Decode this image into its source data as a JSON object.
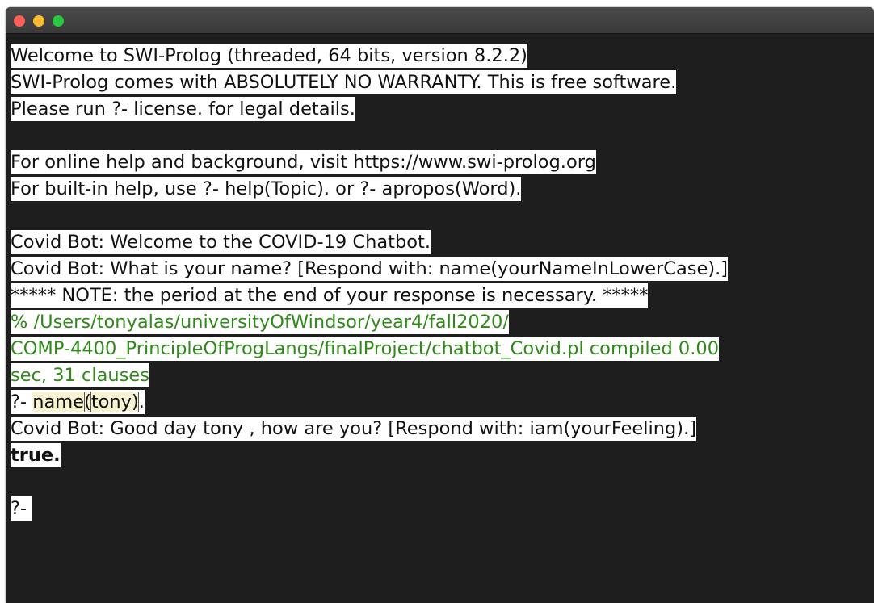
{
  "window": {
    "traffic_lights": {
      "close_color": "#ff5f57",
      "minimize_color": "#febc2e",
      "zoom_color": "#28c840"
    }
  },
  "console": {
    "banner": [
      "Welcome to SWI-Prolog (threaded, 64 bits, version 8.2.2)",
      "SWI-Prolog comes with ABSOLUTELY NO WARRANTY. This is free software.",
      "Please run ?- license. for legal details."
    ],
    "help": [
      "For online help and background, visit https://www.swi-prolog.org",
      "For built-in help, use ?- help(Topic). or ?- apropos(Word)."
    ],
    "bot_intro": [
      "Covid Bot: Welcome to the COVID-19 Chatbot.",
      "Covid Bot: What is your name? [Respond with: name(yourNameInLowerCase).]",
      "***** NOTE: the period at the end of your response is necessary. *****"
    ],
    "compiled": [
      "% /Users/tonyalas/universityOfWindsor/year4/fall2020/",
      "COMP-4400_PrincipleOfProgLangs/finalProject/chatbot_Covid.pl compiled 0.00",
      "sec, 31 clauses"
    ],
    "query": {
      "prompt": "?- ",
      "functor": "name",
      "open_paren": "(",
      "argument": "tony",
      "close_paren": ")",
      "end": "."
    },
    "bot_reply": "Covid Bot: Good day tony , how are you? [Respond with: iam(yourFeeling).]",
    "result": "true.",
    "next_prompt": "?- ",
    "colors": {
      "background": "#1e1e1e",
      "text_highlight": "#ffffff",
      "text": "#111111",
      "compiled_text": "#2f8a1a",
      "query_highlight": "#f6f2d2"
    }
  }
}
